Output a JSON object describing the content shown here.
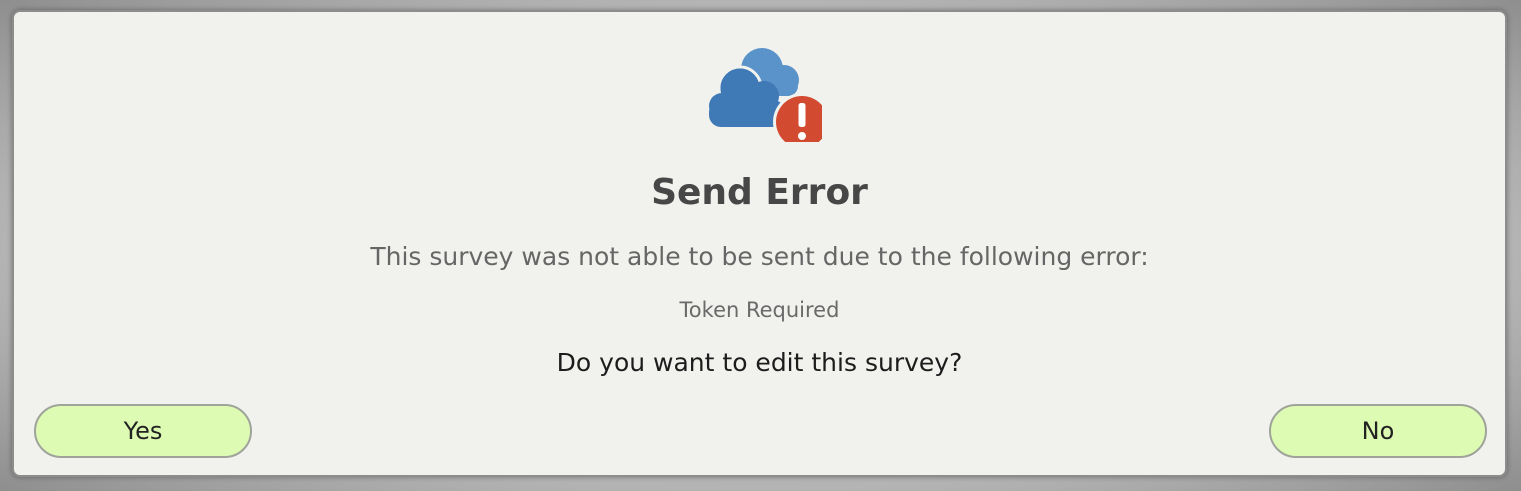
{
  "dialog": {
    "icon": "cloud-error-icon",
    "title": "Send Error",
    "message": "This survey was not able to be sent due to the following error:",
    "error_detail": "Token Required",
    "question": "Do you want to edit this survey?",
    "yes_label": "Yes",
    "no_label": "No"
  },
  "colors": {
    "cloud": "#3f7ab6",
    "error_badge": "#d24a30",
    "button_fill": "#ddfbb2",
    "dialog_background": "#f1f2ee"
  }
}
